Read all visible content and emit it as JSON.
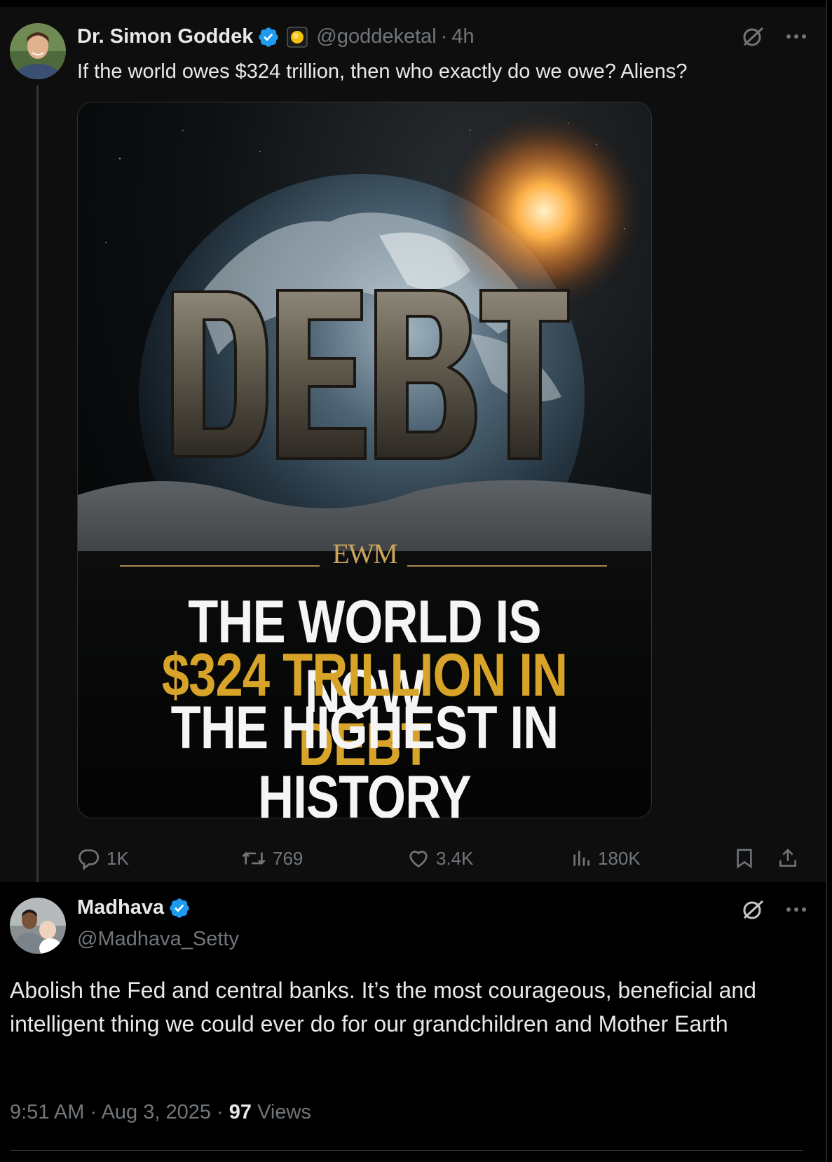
{
  "parent_tweet": {
    "display_name": "Dr. Simon Goddek",
    "handle": "@goddeketal",
    "separator": "·",
    "time": "4h",
    "text": "If the world owes $324 trillion, then who exactly do we owe? Aliens?",
    "image": {
      "word": "DEBT",
      "logo": "EWM",
      "line1": "THE WORLD IS NOW",
      "line2": "$324 TRILLION IN DEBT",
      "line3": "THE HIGHEST IN HISTORY",
      "accent_color": "#d7a429"
    },
    "actions": {
      "replies": "1K",
      "reposts": "769",
      "likes": "3.4K",
      "views": "180K"
    }
  },
  "reply_tweet": {
    "display_name": "Madhava",
    "handle": "@Madhava_Setty",
    "text": "Abolish the Fed and central banks. It’s the most courageous, beneficial and intelligent thing we could ever do for our grandchildren and Mother Earth",
    "time": "9:51 AM",
    "sep1": " · ",
    "date": "Aug 3, 2025",
    "sep2": " · ",
    "views_count": "97",
    "views_label": " Views"
  },
  "icons": {
    "verified": "verified-badge-icon",
    "affiliation": "affiliation-badge-icon",
    "grok": "grok-icon",
    "more": "more-icon",
    "reply": "reply-icon",
    "repost": "repost-icon",
    "like": "like-icon",
    "views": "views-icon",
    "bookmark": "bookmark-icon",
    "share": "share-icon"
  },
  "colors": {
    "verified_blue": "#1d9bf0",
    "muted": "#71767b",
    "text": "#e7e9ea"
  }
}
